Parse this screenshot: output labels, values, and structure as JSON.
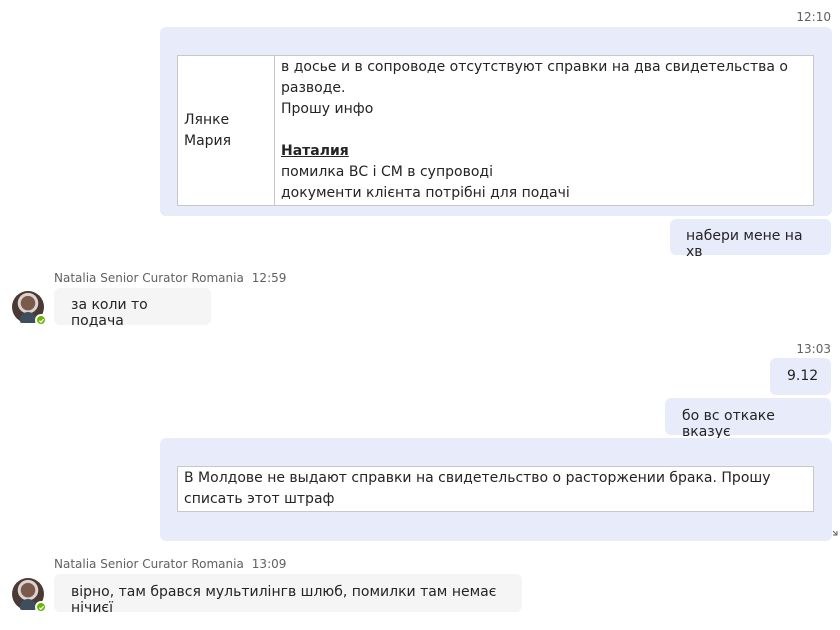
{
  "messages": {
    "m1": {
      "time": "12:10",
      "table": {
        "name": "Лянке Мария",
        "line1": "в досье и в сопроводе отсутствуют справки на два свидетельства о разводе.",
        "line2": "Прошу инфо",
        "mention": "Наталия",
        "line3": "помилка ВС і СМ в супроводі",
        "line4": "документи клієнта потрібні для подачі"
      }
    },
    "m2": {
      "text": "набери мене на хв"
    },
    "m3": {
      "sender": "Natalia Senior Curator Romania",
      "time": "12:59",
      "text": "за коли то подача"
    },
    "m4": {
      "time": "13:03",
      "text": "9.12"
    },
    "m5": {
      "text": "бо вс откаке вказує"
    },
    "m6": {
      "table": {
        "text": "В Молдове не выдают справки на свидетельство о расторжении брака. Прошу списать этот штраф"
      }
    },
    "m7": {
      "sender": "Natalia Senior Curator Romania",
      "time": "13:09",
      "text": "вірно, там брався мультилінгв шлюб, помилки там немає нічиєї"
    }
  },
  "colors": {
    "outgoing_bubble": "#e8ebfa",
    "incoming_bubble": "#f5f5f5",
    "presence_available": "#6bb700"
  },
  "icons": {
    "avatar": "user-avatar",
    "presence": "presence-available-icon"
  }
}
